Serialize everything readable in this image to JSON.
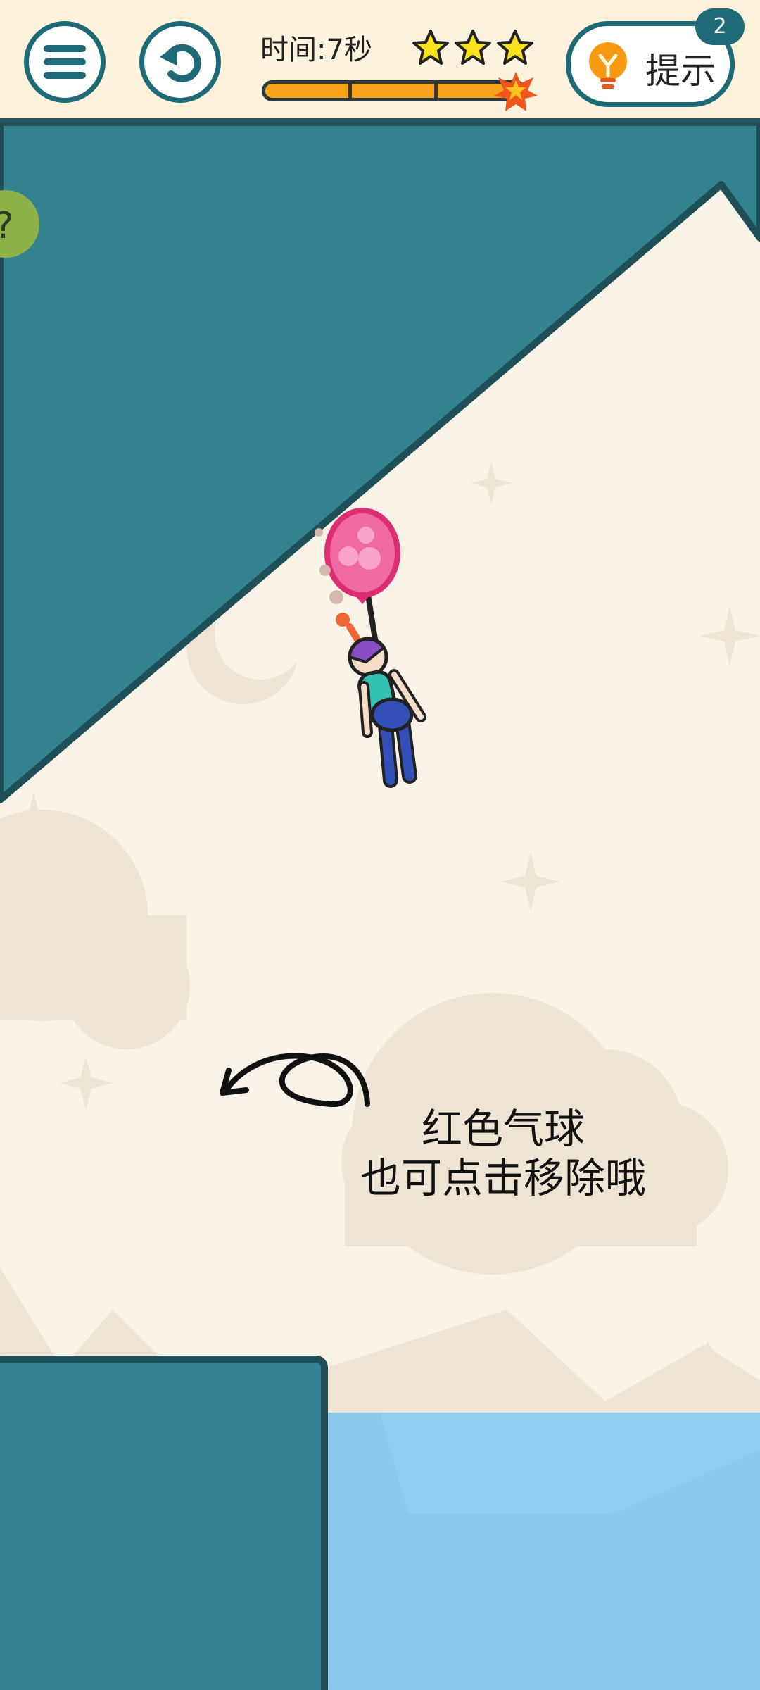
{
  "header": {
    "menu_icon": "menu-icon",
    "restart_icon": "restart-icon",
    "timer_text": "时间:7秒",
    "stars_filled": 3,
    "stars_total": 3,
    "progress": 1.0,
    "hint": {
      "label": "提示",
      "count": "2",
      "icon": "lightbulb-icon"
    }
  },
  "game": {
    "tip_line1": "红色气球",
    "tip_line2": "也可点击移除哦",
    "balloon_color": "#f06aa1",
    "wall_color": "#32838f",
    "water_color": "#8ac8ec",
    "background_color": "#f8f3e6"
  }
}
